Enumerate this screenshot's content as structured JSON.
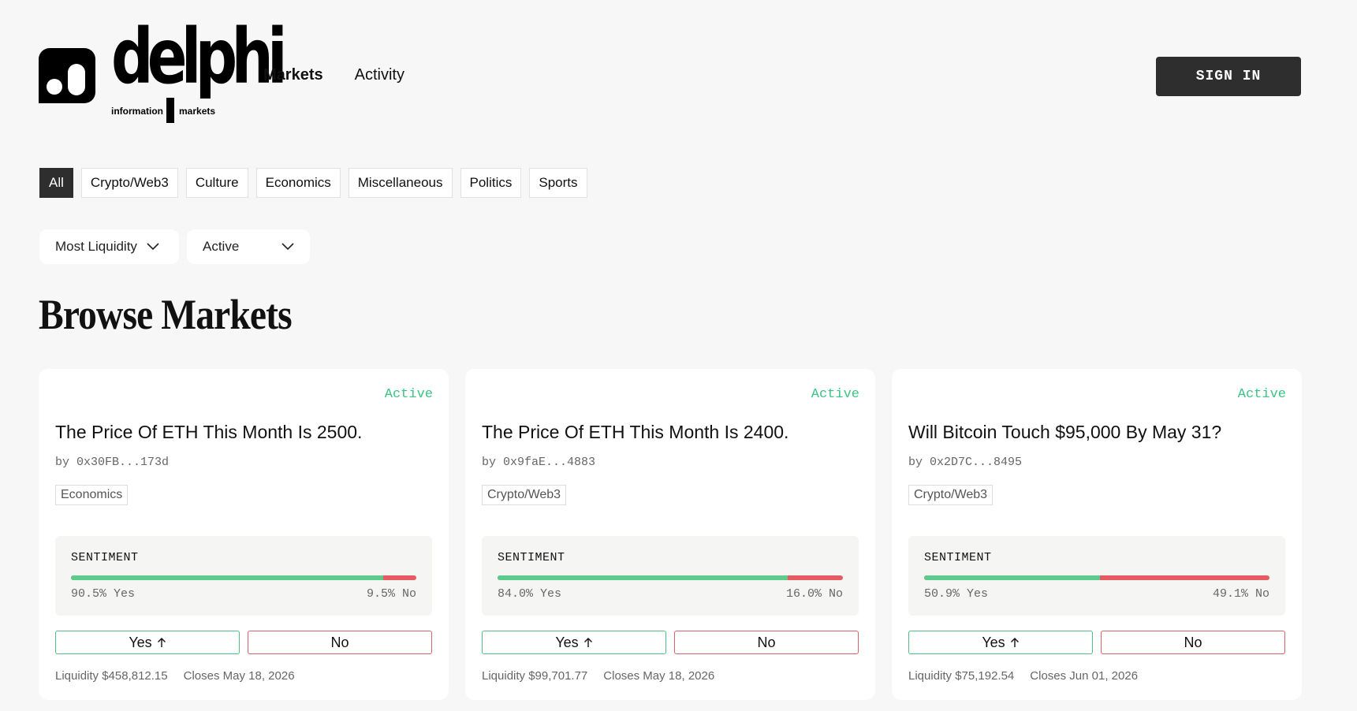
{
  "brand": {
    "wordmark": "delphi",
    "tag_left": "information",
    "tag_right": "markets"
  },
  "nav": {
    "items": [
      {
        "label": "Markets"
      },
      {
        "label": "Activity"
      }
    ],
    "signin_label": "SIGN IN"
  },
  "categories": [
    {
      "label": "All",
      "active": true
    },
    {
      "label": "Crypto/Web3"
    },
    {
      "label": "Culture"
    },
    {
      "label": "Economics"
    },
    {
      "label": "Miscellaneous"
    },
    {
      "label": "Politics"
    },
    {
      "label": "Sports"
    }
  ],
  "filters": {
    "sort": "Most Liquidity",
    "status": "Active"
  },
  "page_title": "Browse Markets",
  "sentiment_label": "SENTIMENT",
  "buttons": {
    "yes": "Yes",
    "no": "No"
  },
  "colors": {
    "active_status": "#3cc483",
    "yes": "#5ecb8c",
    "no": "#e65b62"
  },
  "markets": [
    {
      "status": "Active",
      "title": "The Price Of ETH This Month Is 2500.",
      "author": "by 0x30FB...173d",
      "category": "Economics",
      "yes_fraction": 0.905,
      "yes_text": "90.5% Yes",
      "no_text": "9.5% No",
      "liquidity": "Liquidity $458,812.15",
      "closes": "Closes May 18, 2026"
    },
    {
      "status": "Active",
      "title": "The Price Of ETH This Month Is 2400.",
      "author": "by 0x9faE...4883",
      "category": "Crypto/Web3",
      "yes_fraction": 0.84,
      "yes_text": "84.0% Yes",
      "no_text": "16.0% No",
      "liquidity": "Liquidity $99,701.77",
      "closes": "Closes May 18, 2026"
    },
    {
      "status": "Active",
      "title": "Will Bitcoin Touch $95,000 By May 31?",
      "author": "by 0x2D7C...8495",
      "category": "Crypto/Web3",
      "yes_fraction": 0.509,
      "yes_text": "50.9% Yes",
      "no_text": "49.1% No",
      "liquidity": "Liquidity $75,192.54",
      "closes": "Closes Jun 01, 2026"
    }
  ]
}
